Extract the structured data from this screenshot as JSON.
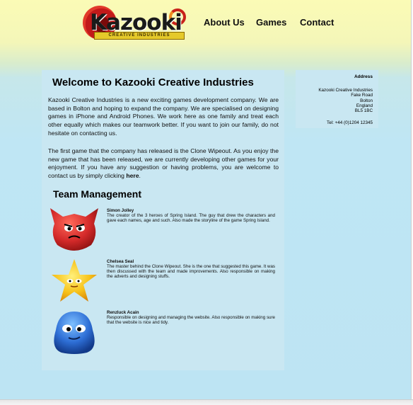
{
  "header": {
    "logo_text": "Kazooki",
    "logo_tagline": "CREATIVE INDUSTRIES"
  },
  "nav": {
    "about": "About Us",
    "games": "Games",
    "contact": "Contact"
  },
  "main": {
    "title": "Welcome to Kazooki Creative Industries",
    "paragraph1": "Kazooki Creative Industries is a new exciting games development company. We are based in Bolton and hoping to expand the company. We are specialised on designing games in iPhone and Android Phones. We work here as one family and treat each other equally which makes our teamwork better. If you want to join our family, do not hesitate on contacting us.",
    "paragraph2": "The first game that the company has released is the Clone Wipeout. As you enjoy the new game that has been released, we are currently developing other games for your enjoyment. If you have any suggestion or having problems, you are welcome to contact us by simply clicking ",
    "paragraph2_link": "here",
    "paragraph2_end": ".",
    "team_title": "Team Management",
    "members": [
      {
        "name": "Simon Jolley",
        "description": "The creator of the 3 heroes of Spring Island. The guy that drew the characters and gave each names, age and such. Also made the storyline of the game Spring Island."
      },
      {
        "name": "Chelsea Seal",
        "description": "The master behind the Clone Wipeout. She is the one that suggested this game. It was then discussed with the team and made improvements. Also responsible on making the adverts and designing stuffs."
      },
      {
        "name": "Renzluck Acain",
        "description": "Responsible on designing and managing the website. Also responsible on making sure that the website is nice and tidy."
      }
    ]
  },
  "sidebar": {
    "address_title": "Address",
    "address_lines": [
      "Kazooki Creative Industries",
      "Fake Road",
      "Bolton",
      "England",
      "BL5 1BC"
    ],
    "tel": "Tel: +44 (0)1204 12345"
  },
  "colors": {
    "header_yellow": "#fbfbb6",
    "page_blue": "#bde4f3",
    "panel_blue": "#c9e7f2",
    "mascot_red": "#d42a2a",
    "mascot_yellow": "#f7c21a",
    "mascot_blue": "#2e6fd6"
  }
}
